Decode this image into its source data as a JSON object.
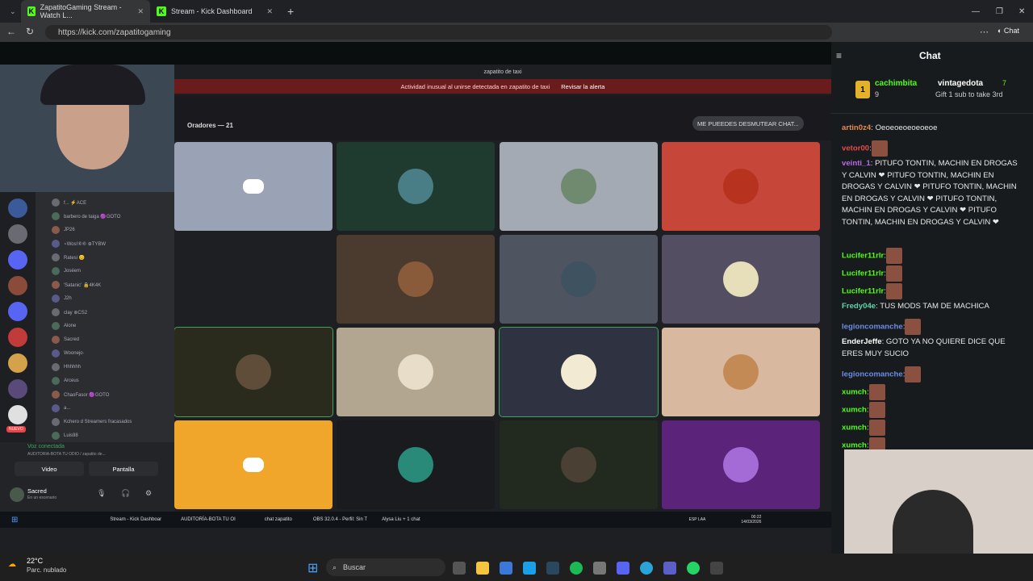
{
  "browser": {
    "tabs": [
      {
        "label": "ZapatitoGaming Stream - Watch L..."
      },
      {
        "label": "Stream - Kick Dashboard"
      }
    ],
    "url": "https://kick.com/zapatitogaming"
  },
  "discord": {
    "window_title": "zapatito de taxi",
    "alert_text": "Actividad inusual al unirse detectada en zapatito de taxi",
    "alert_link": "Revisar la alerta",
    "speakers_label": "Oradores — 21",
    "unmute_pill": "ME PUEEDES DESMUTEAR CHAT...",
    "voice_connected": "Voz conectada",
    "voice_channel": "AUDITORÍA-BOTA TU ODIO / zapatito de...",
    "video_button": "Video",
    "screen_button": "Pantalla",
    "user_name": "Sacred",
    "user_status": "En un escenario",
    "new_badge": "NUEVO",
    "members": [
      {
        "name": "f... ⚡ACE"
      },
      {
        "name": "barbero de taiga 🟣GOTO"
      },
      {
        "name": "JP26"
      },
      {
        "name": "⋆Wos!⑥⑥ ⊕TYBW"
      },
      {
        "name": "Ratesi 😊"
      },
      {
        "name": "Joséem"
      },
      {
        "name": "'Satanic' 🔒4K4K"
      },
      {
        "name": "J2h"
      },
      {
        "name": "clay ⊕CS2"
      },
      {
        "name": "Alone"
      },
      {
        "name": "Sacred"
      },
      {
        "name": "Woonejo·"
      },
      {
        "name": "Hhhhhh"
      },
      {
        "name": "Arceus"
      },
      {
        "name": "ChaoFasor 🟣GOTO"
      },
      {
        "name": "a..."
      },
      {
        "name": "Kchero d Streamers fracasados"
      },
      {
        "name": "Luis98"
      }
    ],
    "tiles": [
      {
        "color": "#9aa2b5",
        "kind": "discord"
      },
      {
        "color": "#1f3a2e",
        "kind": "avatar",
        "av": "#4a7e86"
      },
      {
        "color": "#a4aab3",
        "kind": "avatar",
        "av": "#6f8a6f"
      },
      {
        "color": "#c6463a",
        "kind": "avatar",
        "av": "#b8331f"
      },
      {
        "color": "#1e1f22",
        "kind": "empty"
      },
      {
        "color": "#4b3b2e",
        "kind": "avatar",
        "av": "#8a5b3a"
      },
      {
        "color": "#4f5461",
        "kind": "avatar",
        "av": "#3f5260"
      },
      {
        "color": "#534e61",
        "kind": "avatar",
        "av": "#e6dfba"
      },
      {
        "color": "#2a2b1d",
        "kind": "avatar",
        "av": "#5f4d3a",
        "outline": "#3ba55c"
      },
      {
        "color": "#b2a690",
        "kind": "avatar",
        "av": "#e8ddc9"
      },
      {
        "color": "#2f3240",
        "kind": "avatar",
        "av": "#f2ead2",
        "outline": "#3ba55c"
      },
      {
        "color": "#d8b9a0",
        "kind": "avatar",
        "av": "#c48a56"
      },
      {
        "color": "#f0a52b",
        "kind": "discord"
      },
      {
        "color": "#1a1b1e",
        "kind": "avatar",
        "av": "#2a8a7a"
      },
      {
        "color": "#222a20",
        "kind": "avatar",
        "av": "#4a4033"
      },
      {
        "color": "#5b247a",
        "kind": "avatar",
        "av": "#a46ad6"
      }
    ],
    "taskbar": [
      {
        "label": "Stream - Kick Dashboar"
      },
      {
        "label": "AUDITORÍA-BOTA TU OI"
      },
      {
        "label": "chat zapatito"
      },
      {
        "label": "OBS 32.0.4 - Perfil: Sin T"
      },
      {
        "label": "Alysa Liu + 1 chat"
      }
    ],
    "clock_time": "00:22",
    "clock_date": "14/03/2026",
    "lang": "ESP LAA"
  },
  "chat": {
    "title": "Chat",
    "pinned": {
      "rank": "1",
      "user1": "cachimbita",
      "user1_count": "9",
      "user2": "vintagedota",
      "user2_count": "7",
      "gift_text": "Gift 1 sub to take 3rd"
    },
    "messages": [
      {
        "user": "artin0z4",
        "color": "#e68a4f",
        "text": ": Oeoeoeoeoeoeoe"
      },
      {
        "user": "vetor00",
        "color": "#e34a4a",
        "text": ":"
      },
      {
        "user": "veinti_1",
        "color": "#b56ae6",
        "text": ": PITUFO TONTIN, MACHIN EN DROGAS Y CALVIN ❤ PITUFO TONTIN, MACHIN EN DROGAS Y CALVIN ❤ PITUFO TONTIN, MACHIN EN DROGAS Y CALVIN ❤ PITUFO TONTIN, MACHIN EN DROGAS Y CALVIN ❤ PITUFO TONTIN, MACHIN EN DROGAS Y CALVIN ❤"
      },
      {
        "user": "Lucifer11rlr",
        "color": "#53fc18",
        "text": ":"
      },
      {
        "user": "Lucifer11rlr",
        "color": "#53fc18",
        "text": ":"
      },
      {
        "user": "Lucifer11rlr",
        "color": "#53fc18",
        "text": ":"
      },
      {
        "user": "Fredy04e",
        "color": "#5fd3a6",
        "text": ": TUS MODS TAM DE MACHICA"
      },
      {
        "user": "legioncomanche",
        "color": "#6a8ce6",
        "text": ":"
      },
      {
        "user": "EnderJeffe",
        "color": "#ffffff",
        "text": ": GOTO YA NO QUIERE DICE QUE ERES MUY SUCIO"
      },
      {
        "user": "legioncomanche",
        "color": "#6a8ce6",
        "text": ":"
      },
      {
        "user": "xumch",
        "color": "#53fc18",
        "text": ":"
      },
      {
        "user": "xumch",
        "color": "#53fc18",
        "text": ":"
      },
      {
        "user": "xumch",
        "color": "#53fc18",
        "text": ":"
      },
      {
        "user": "xumch",
        "color": "#53fc18",
        "text": ":"
      }
    ]
  },
  "windows": {
    "weather_temp": "22°C",
    "weather_desc": "Parc. nublado",
    "search_placeholder": "Buscar"
  }
}
